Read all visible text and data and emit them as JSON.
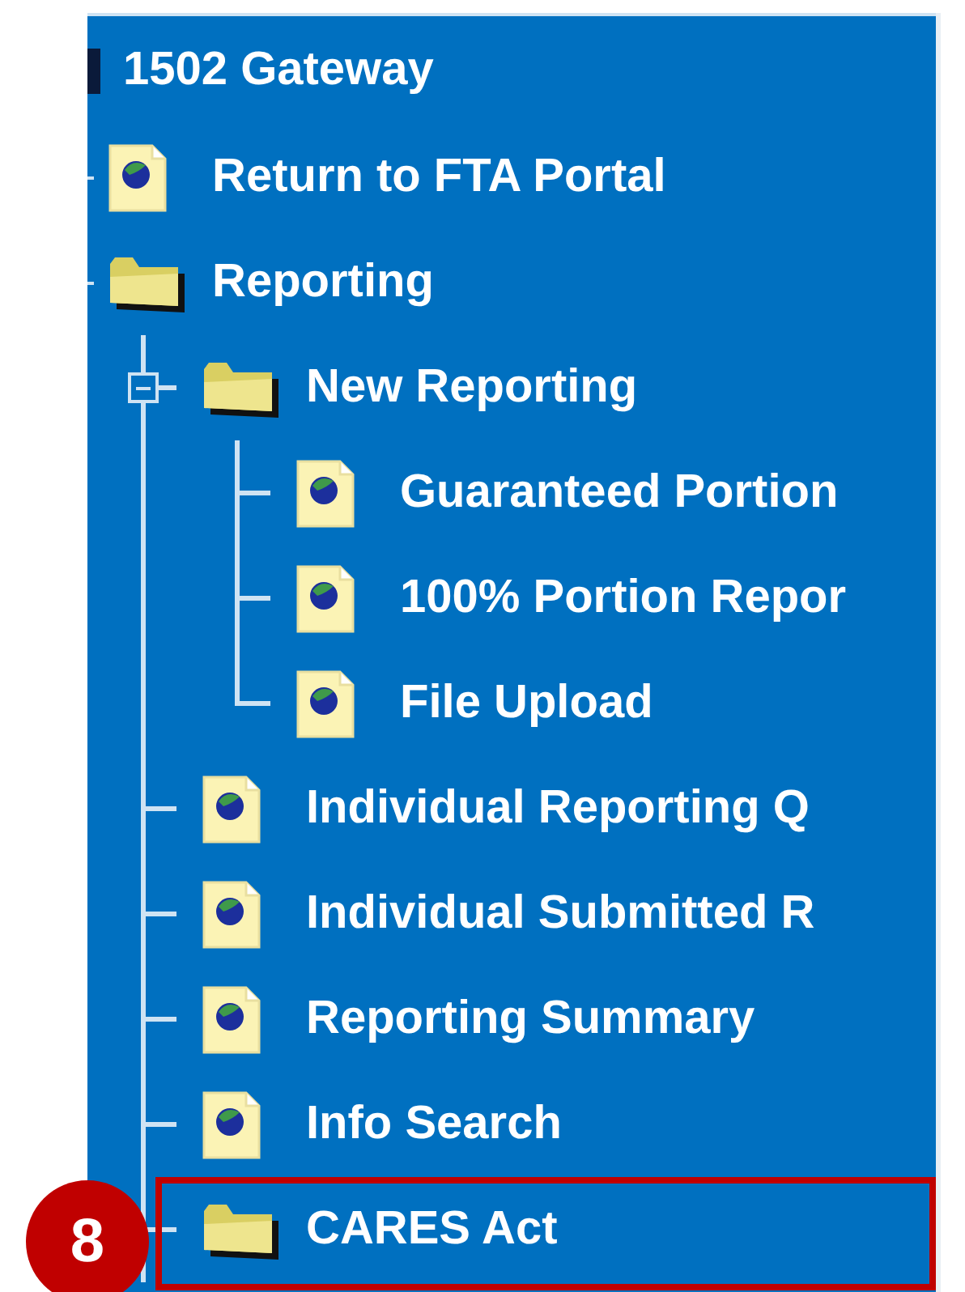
{
  "tree": {
    "root": {
      "label": "1502 Gateway"
    },
    "items": [
      {
        "label": "Return to FTA Portal",
        "kind": "page",
        "highlighted": false
      },
      {
        "label": "Reporting",
        "kind": "folder",
        "highlighted": false,
        "children": [
          {
            "label": "New Reporting",
            "kind": "folder",
            "expanded": true,
            "highlighted": false,
            "children": [
              {
                "label": "Guaranteed Portion",
                "kind": "page",
                "highlighted": false
              },
              {
                "label": "100% Portion Repor",
                "kind": "page",
                "highlighted": false
              },
              {
                "label": "File Upload",
                "kind": "page",
                "highlighted": false
              }
            ]
          },
          {
            "label": "Individual Reporting Q",
            "kind": "page",
            "highlighted": false
          },
          {
            "label": "Individual Submitted R",
            "kind": "page",
            "highlighted": false
          },
          {
            "label": "Reporting Summary",
            "kind": "page",
            "highlighted": false
          },
          {
            "label": "Info Search",
            "kind": "page",
            "highlighted": false
          },
          {
            "label": "CARES Act",
            "kind": "folder",
            "highlighted": true,
            "callout": "8"
          }
        ]
      }
    ]
  }
}
